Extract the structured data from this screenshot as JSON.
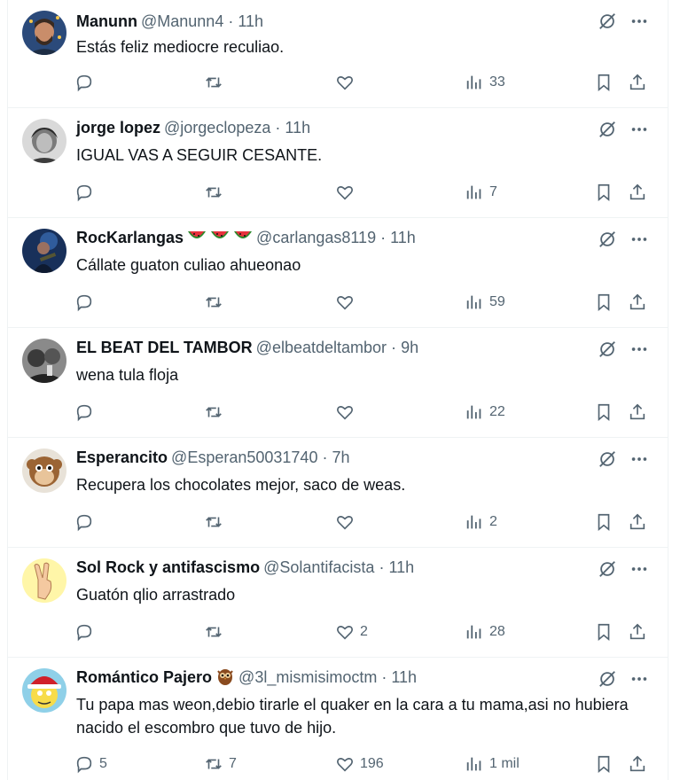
{
  "colors": {
    "text": "#0f1419",
    "muted": "#536471",
    "border": "#eff3f4"
  },
  "tweets": [
    {
      "name": "Manunn",
      "handle": "@Manunn4",
      "sep": "·",
      "time": "11h",
      "emoji": "",
      "text": "Estás feliz mediocre reculiao.",
      "reply": "",
      "retweet": "",
      "like": "",
      "views": "33"
    },
    {
      "name": "jorge lopez",
      "handle": "@jorgeclopeza",
      "sep": "·",
      "time": "11h",
      "emoji": "",
      "text": "IGUAL VAS A SEGUIR CESANTE.",
      "reply": "",
      "retweet": "",
      "like": "",
      "views": "7"
    },
    {
      "name": "RocKarlangas",
      "handle": "@carlangas8119",
      "sep": "·",
      "time": "11h",
      "emoji": "watermelon-icon x3",
      "text": "Cállate guaton culiao ahueonao",
      "reply": "",
      "retweet": "",
      "like": "",
      "views": "59"
    },
    {
      "name": "EL BEAT DEL TAMBOR",
      "handle": "@elbeatdeltambor",
      "sep": "·",
      "time": "9h",
      "emoji": "",
      "text": "wena tula floja",
      "reply": "",
      "retweet": "",
      "like": "",
      "views": "22"
    },
    {
      "name": "Esperancito",
      "handle": "@Esperan50031740",
      "sep": "·",
      "time": "7h",
      "emoji": "",
      "text": "Recupera los chocolates mejor, saco de weas.",
      "reply": "",
      "retweet": "",
      "like": "",
      "views": "2"
    },
    {
      "name": "Sol Rock y antifascismo",
      "handle": "@Solantifacista",
      "sep": "·",
      "time": "11h",
      "emoji": "",
      "text": "Guatón qlio arrastrado",
      "reply": "",
      "retweet": "",
      "like": "2",
      "views": "28"
    },
    {
      "name": "Romántico Pajero",
      "handle": "@3l_mismisimoctm",
      "sep": "·",
      "time": "11h",
      "emoji": "owl-icon",
      "text": "Tu papa mas weon,debio tirarle el quaker en la cara a tu mama,asi no hubiera nacido el escombro que tuvo de hijo.",
      "reply": "5",
      "retweet": "7",
      "like": "196",
      "views": "1 mil"
    }
  ]
}
